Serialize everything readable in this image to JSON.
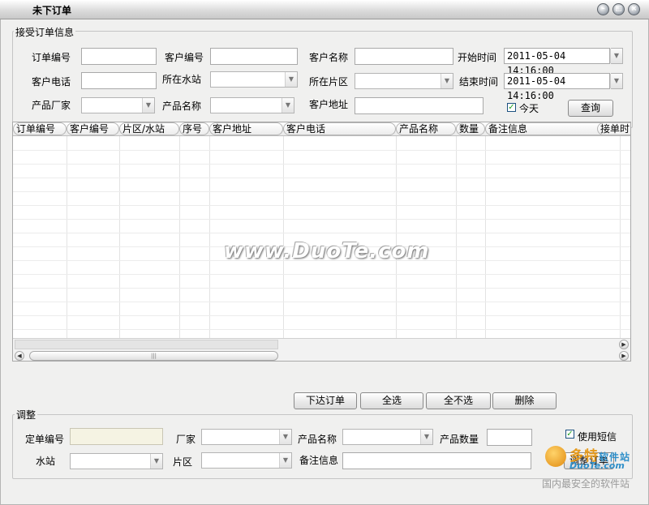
{
  "window": {
    "title": "未下订单"
  },
  "receive_group": {
    "title": "接受订单信息",
    "order_no_label": "订单编号",
    "customer_no_label": "客户编号",
    "customer_name_label": "客户名称",
    "start_time_label": "开始时间",
    "start_time_value": "2011-05-04 14:16:00",
    "customer_phone_label": "客户电话",
    "station_label": "所在水站",
    "area_label": "所在片区",
    "end_time_label": "结束时间",
    "end_time_value": "2011-05-04 14:16:00",
    "manufacturer_label": "产品厂家",
    "product_name_label": "产品名称",
    "customer_address_label": "客户地址",
    "today_label": "今天",
    "today_checked": true,
    "query_button": "查询"
  },
  "grid": {
    "columns": [
      "订单编号",
      "客户编号",
      "片区/水站",
      "序号",
      "客户地址",
      "客户电话",
      "产品名称",
      "数量",
      "备注信息",
      "接单时间"
    ]
  },
  "actions": {
    "issue_order": "下达订单",
    "select_all": "全选",
    "select_none": "全不选",
    "delete": "删除"
  },
  "adjust_group": {
    "title": "调整",
    "order_no_label": "定单编号",
    "manufacturer_label": "厂家",
    "product_name_label": "产品名称",
    "product_qty_label": "产品数量",
    "use_sms_label": "使用短信",
    "use_sms_checked": true,
    "station_label": "水站",
    "area_label": "片区",
    "remark_label": "备注信息",
    "adjust_button": "调整订单"
  },
  "watermark": {
    "text": "www.DuoTe.com"
  },
  "logo": {
    "line1": "多特",
    "line1_small": "软件站",
    "line2": "DuoTe.com",
    "line3": "国内最安全的软件站"
  },
  "colors": {
    "window_bg": "#f0f0ef",
    "disabled_field": "#f5f3e3",
    "checkmark": "#21a121"
  }
}
